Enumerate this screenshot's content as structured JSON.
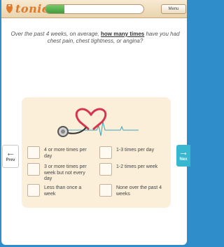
{
  "header": {
    "logo_text": "tonic",
    "progress": {
      "percent": 19,
      "label": "19% complete"
    },
    "menu_label": "Menu"
  },
  "question": {
    "prefix": "Over the past 4 weeks, on average, ",
    "emphasis": "how many times",
    "suffix": " have you had chest pain, chest tightness, or angina?"
  },
  "options": [
    "4 or more times per day",
    "1-3 times per day",
    "3 or more times per week but not every day",
    "1-2 times per week",
    "Less than once a week",
    "None over the past 4 weeks"
  ],
  "nav": {
    "prev_label": "Prev",
    "next_label": "Nex"
  },
  "colors": {
    "accent": "#e07a2a",
    "progress_green": "#4caf50",
    "card_bg": "#fbefd9",
    "next_blue": "#38b7d1",
    "frame_blue": "#2f8ec9",
    "heart_red": "#d9344e"
  },
  "icons": [
    "tonic-logo-icon",
    "stethoscope-heart-icon",
    "arrow-left-icon",
    "arrow-right-icon"
  ]
}
